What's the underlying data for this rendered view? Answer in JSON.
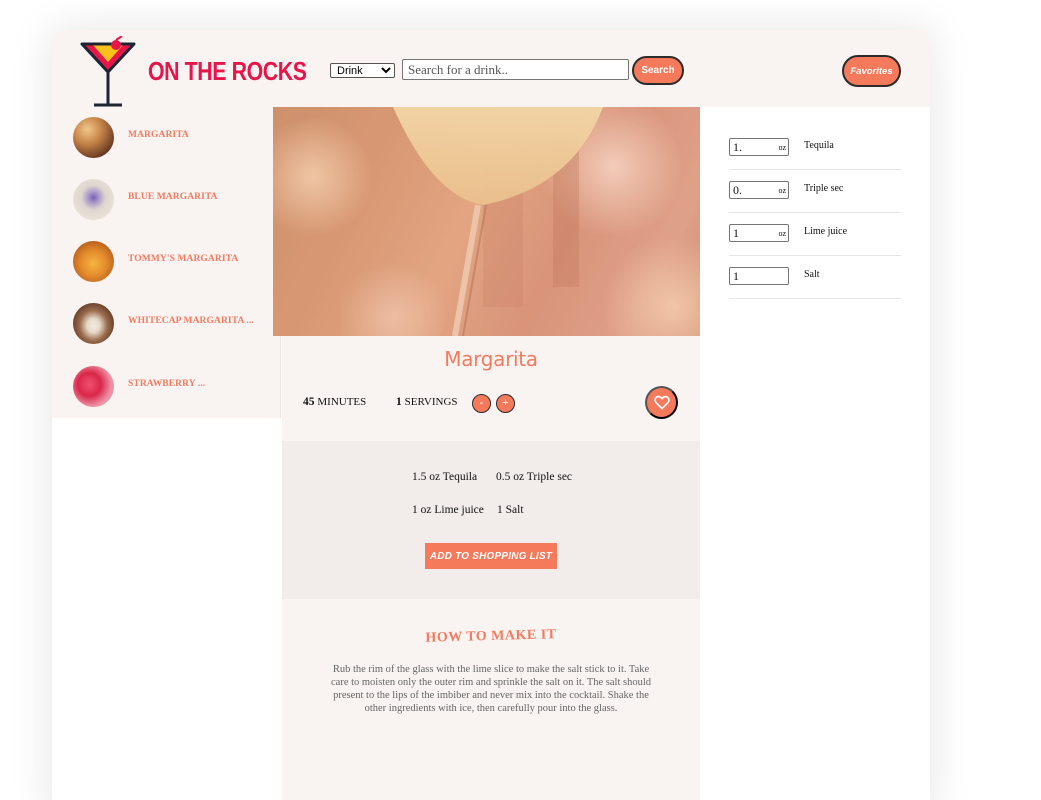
{
  "header": {
    "logo_text": "ON THE ROCKS",
    "select_value": "Drink",
    "search_placeholder": "Search for a drink..",
    "search_label": "Search",
    "favorites_label": "Favorites"
  },
  "sidebar": {
    "items": [
      {
        "name": "MARGARITA"
      },
      {
        "name": "BLUE MARGARITA"
      },
      {
        "name": "TOMMY'S MARGARITA"
      },
      {
        "name": "WHITECAP MARGARITA ..."
      },
      {
        "name": "STRAWBERRY ..."
      }
    ]
  },
  "drink": {
    "title": "Margarita",
    "minutes_value": "45",
    "minutes_label": "MINUTES",
    "servings_value": "1",
    "servings_label": "SERVINGS",
    "minus": "-",
    "plus": "+",
    "ingredients": [
      "1.5 oz Tequila",
      "0.5 oz Triple sec",
      "1 oz Lime juice",
      "1 Salt"
    ],
    "add_label": "ADD TO SHOPPING LIST",
    "howto_title": "HOW TO MAKE IT",
    "howto_text": "Rub the rim of the glass with the lime slice to make the salt stick to it. Take care to moisten only the outer rim and sprinkle the salt on it. The salt should present to the lips of the imbiber and never mix into the cocktail. Shake the other ingredients with ice, then carefully pour into the glass."
  },
  "amounts": [
    {
      "value": "1.",
      "unit": "oz",
      "name": "Tequila"
    },
    {
      "value": "0.",
      "unit": "oz",
      "name": "Triple sec"
    },
    {
      "value": "1",
      "unit": "oz",
      "name": "Lime juice"
    },
    {
      "value": "1",
      "unit": "",
      "name": "Salt"
    }
  ],
  "colors": {
    "accent": "#f57a5c",
    "logo_red": "#e8154a",
    "panel": "#f9f3f1"
  }
}
